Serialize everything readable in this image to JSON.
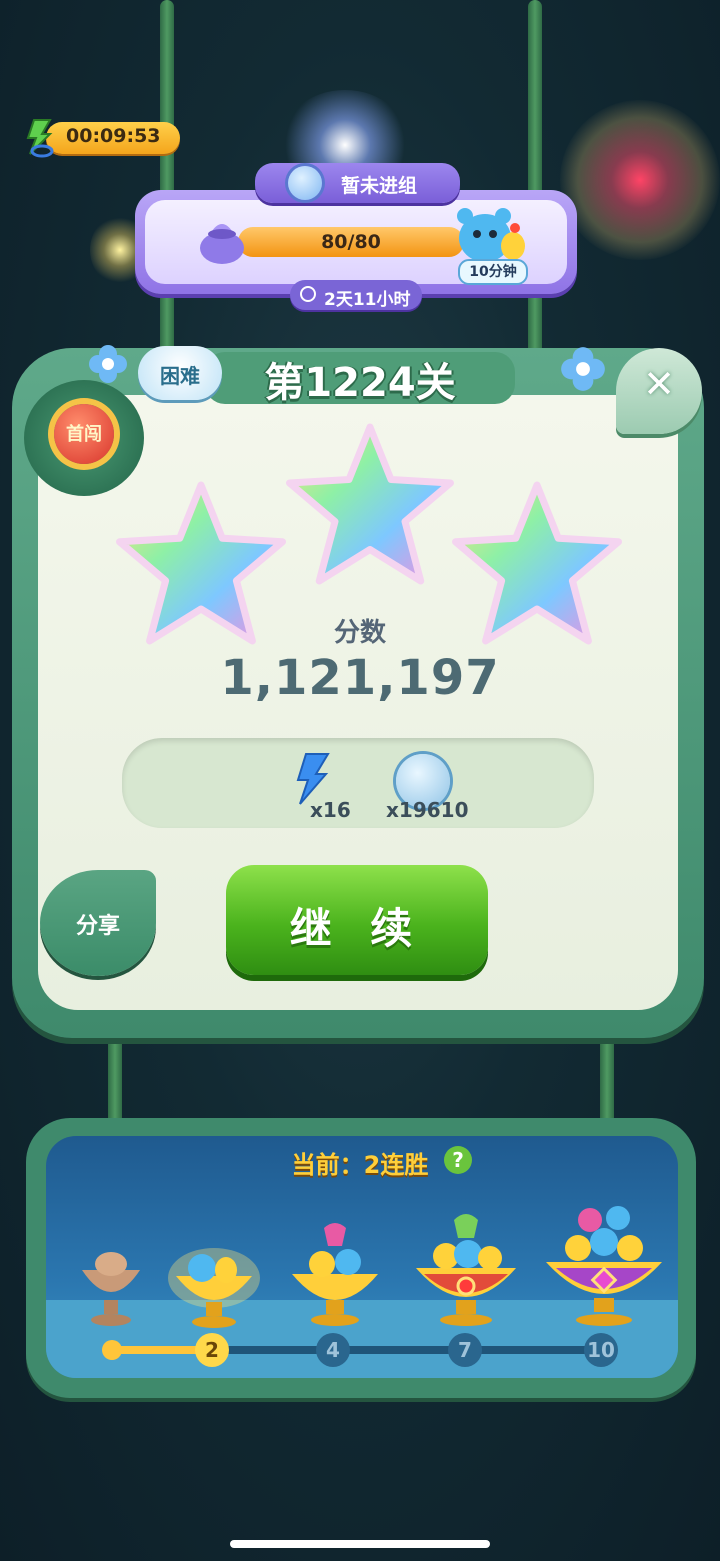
{
  "energy": {
    "timer": "00:09:53",
    "icon": "infinite-energy-icon"
  },
  "event": {
    "tab_label": "暂未进组",
    "progress_text": "80/80",
    "progress_fraction": 1.0,
    "reward_duration": "10分钟",
    "time_left": "2天11小时"
  },
  "level": {
    "title": "第1224关",
    "difficulty": "困难",
    "first_pass_badge": "首闯",
    "stars_earned": 3,
    "stars_total": 3,
    "score_label": "分数",
    "score_value": "1,121,197"
  },
  "rewards": [
    {
      "icon": "lightning-icon",
      "count": "x16"
    },
    {
      "icon": "leaf-coin-icon",
      "count": "x19610"
    }
  ],
  "buttons": {
    "continue": "继 续",
    "share": "分享",
    "close": "✕"
  },
  "streak": {
    "title": "当前：2连胜",
    "help": "?",
    "current": 2,
    "nodes": [
      "2",
      "4",
      "7",
      "10"
    ]
  },
  "colors": {
    "accent_green": "#4bb31d",
    "frame_green": "#3f8a6c",
    "gold": "#ffc53a"
  }
}
